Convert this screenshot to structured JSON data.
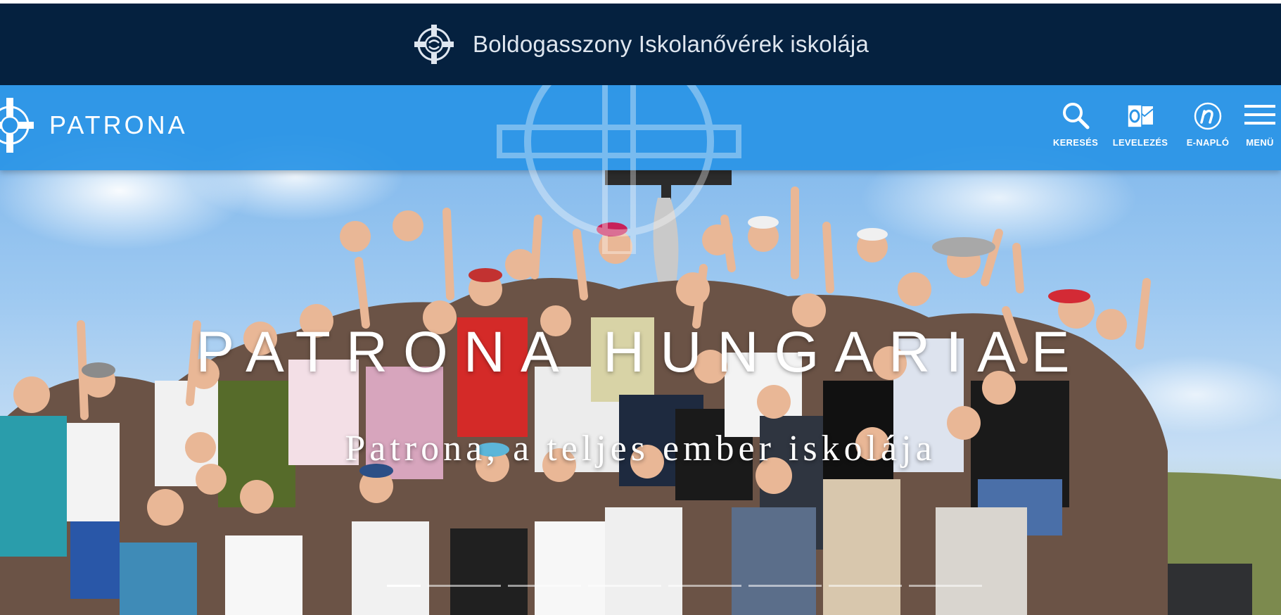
{
  "school_bar": {
    "name": "Boldogasszony Iskolanővérek iskolája"
  },
  "nav": {
    "brand": "PATRONA",
    "actions": [
      {
        "label": "KERESÉS",
        "icon": "search-icon"
      },
      {
        "label": "LEVELEZÉS",
        "icon": "outlook-mail-icon"
      },
      {
        "label": "E-NAPLÓ",
        "icon": "e-naplo-icon"
      },
      {
        "label": "MENÜ",
        "icon": "hamburger-menu-icon"
      }
    ]
  },
  "hero": {
    "title": "PATRONA HUNGARIAE",
    "subtitle": "Patrona, a teljes ember iskolája",
    "slides_total": 8,
    "active_slide": 1
  },
  "colors": {
    "school_bar_bg": "#05213f",
    "nav_bg": "#2a94e6",
    "text": "#ffffff"
  }
}
